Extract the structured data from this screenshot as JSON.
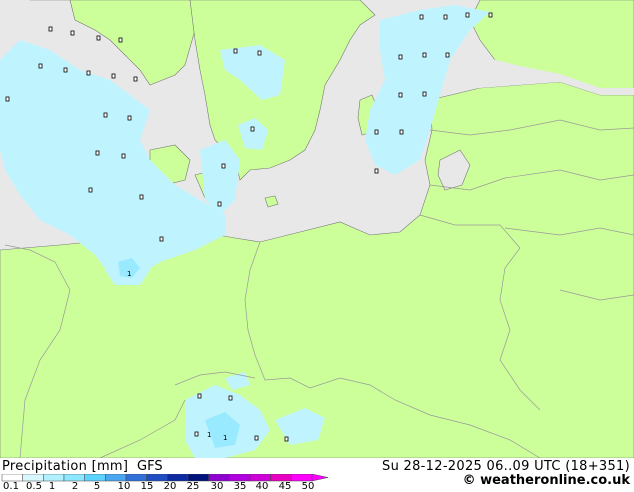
{
  "map": {
    "station_values": [
      "1",
      "1",
      "1"
    ],
    "colors": {
      "sea": "#e8e8e8",
      "land": "#ccff99",
      "precip_light": "#bff4ff",
      "precip_mid": "#99eaff",
      "border": "#999999",
      "coast": "#777777"
    }
  },
  "legend": {
    "title": "Precipitation [mm]",
    "model": "GFS",
    "valid_time": "Su 28-12-2025 06..09 UTC (18+351)",
    "credit": "© weatheronline.co.uk",
    "scale_labels": [
      "0.1",
      "0.5",
      "1",
      "2",
      "5",
      "10",
      "15",
      "20",
      "25",
      "30",
      "35",
      "40",
      "45",
      "50"
    ],
    "scale_colors": [
      "#ffffff",
      "#d8f8ff",
      "#b0f0ff",
      "#8ce6ff",
      "#5cd2ff",
      "#4aa6f0",
      "#3070d8",
      "#1f4cc0",
      "#0d2aa0",
      "#00137a",
      "#9000d0",
      "#b000e0",
      "#d000d8",
      "#e800c0",
      "#ff00ff"
    ]
  }
}
